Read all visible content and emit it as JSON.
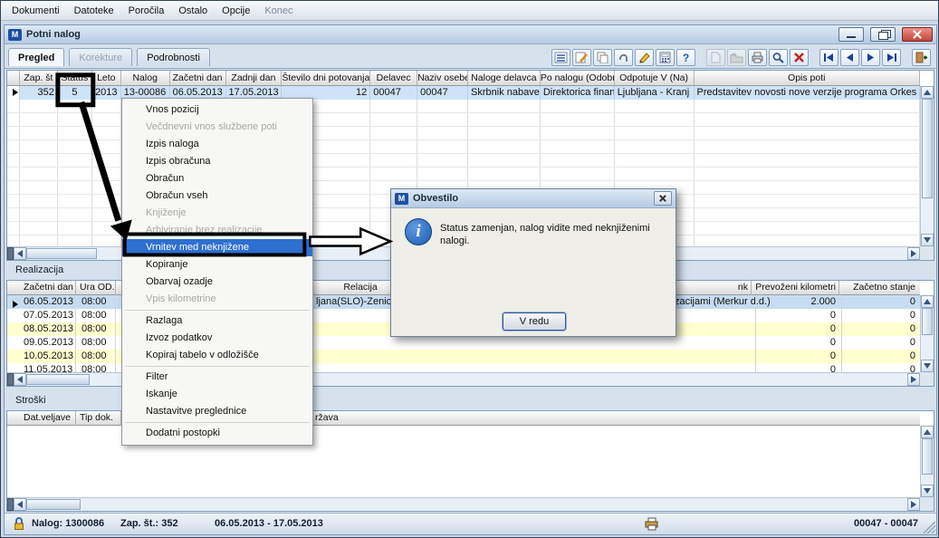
{
  "menubar": {
    "items": [
      "Dokumenti",
      "Datoteke",
      "Poročila",
      "Ostalo",
      "Opcije",
      "Konec"
    ]
  },
  "window": {
    "title": "Potni nalog"
  },
  "tabs": {
    "pregled": "Pregled",
    "korekture": "Korekture",
    "podrobnosti": "Podrobnosti"
  },
  "grid": {
    "headers": [
      "Zap. št",
      "Status",
      "Leto",
      "Nalog",
      "Začetni dan",
      "Zadnji dan",
      "Število dni potovanja",
      "Delavec",
      "Naziv osebe",
      "Naloge delavca",
      "Po nalogu (Odobril)",
      "Odpotuje V (Na)",
      "Opis poti"
    ],
    "row": [
      "352",
      "5",
      "2013",
      "13-00086",
      "06.05.2013",
      "17.05.2013",
      "12",
      "00047",
      "00047",
      "Skrbnik nabave",
      "Direktorica financ",
      "Ljubljana - Kranj",
      "Predstavitev novosti nove verzije programa Orkes"
    ]
  },
  "context_menu": {
    "items": [
      "Vnos pozicij",
      "Večdnevni vnos službene poti",
      "Izpis naloga",
      "Izpis obračuna",
      "Obračun",
      "Obračun vseh",
      "Knjiženje",
      "Arhiviranje brez realizacije",
      "Vrnitev med neknjižene",
      "Kopiranje",
      "Obarvaj ozadje",
      "Vpis kilometrine",
      "Razlaga",
      "Izvoz podatkov",
      "Kopiraj tabelo v odložišče",
      "Filter",
      "Iskanje",
      "Nastavitve preglednice",
      "Dodatni postopki"
    ]
  },
  "dialog": {
    "title": "Obvestilo",
    "message": "Status zamenjan, nalog vidite med neknjiženimi nalogi.",
    "ok": "V redu"
  },
  "realizacija": {
    "label": "Realizacija",
    "headers": {
      "date": "Začetni dan",
      "time": "Ura OD.",
      "relacija": "Relacija",
      "trunc": "nk",
      "km": "Prevoženi kilometri",
      "start": "Začetno stanje"
    },
    "rows": [
      {
        "date": "06.05.2013",
        "time": "08:00",
        "relacija": "ljana(SLO)-Zenica",
        "note": "zacijami (Merkur d.d.)",
        "km": "2.000",
        "start": "0"
      },
      {
        "date": "07.05.2013",
        "time": "08:00",
        "km": "0",
        "start": "0"
      },
      {
        "date": "08.05.2013",
        "time": "08:00",
        "km": "0",
        "start": "0"
      },
      {
        "date": "09.05.2013",
        "time": "08:00",
        "km": "0",
        "start": "0"
      },
      {
        "date": "10.05.2013",
        "time": "08:00",
        "km": "0",
        "start": "0"
      },
      {
        "date": "11.05.2013",
        "time": "08:00",
        "km": "0",
        "start": "0"
      }
    ]
  },
  "stroski": {
    "label": "Stroški",
    "headers": {
      "date": "Dat.veljave",
      "tip": "Tip dok.",
      "trunc": "ržava"
    }
  },
  "statusbar": {
    "nalog": "Nalog: 1300086",
    "zap": "Zap. št.:  352",
    "dates": "06.05.2013 - 17.05.2013",
    "right": "00047 - 00047"
  },
  "icons": {
    "toolbar": [
      "list-icon",
      "edit-icon",
      "copy-icon",
      "attach-icon",
      "pencil-icon",
      "calculator-icon",
      "help-icon",
      "new-document-icon",
      "open-folder-icon",
      "print-icon",
      "preview-icon",
      "delete-icon",
      "first-record-icon",
      "prev-record-icon",
      "next-record-icon",
      "last-record-icon",
      "exit-icon"
    ],
    "menu": [
      "help-icon",
      "copy-icon",
      "filter-icon",
      "search-icon",
      "table-icon",
      "procedures-icon"
    ],
    "dialog": "info-icon",
    "statusbar": [
      "lock-icon",
      "printer-icon"
    ]
  },
  "colors": {
    "menu_highlight": "#2e6fd0",
    "row_selection": "#cfe3f7",
    "row_yellow": "#ffffcf",
    "annotation": "#000000"
  }
}
